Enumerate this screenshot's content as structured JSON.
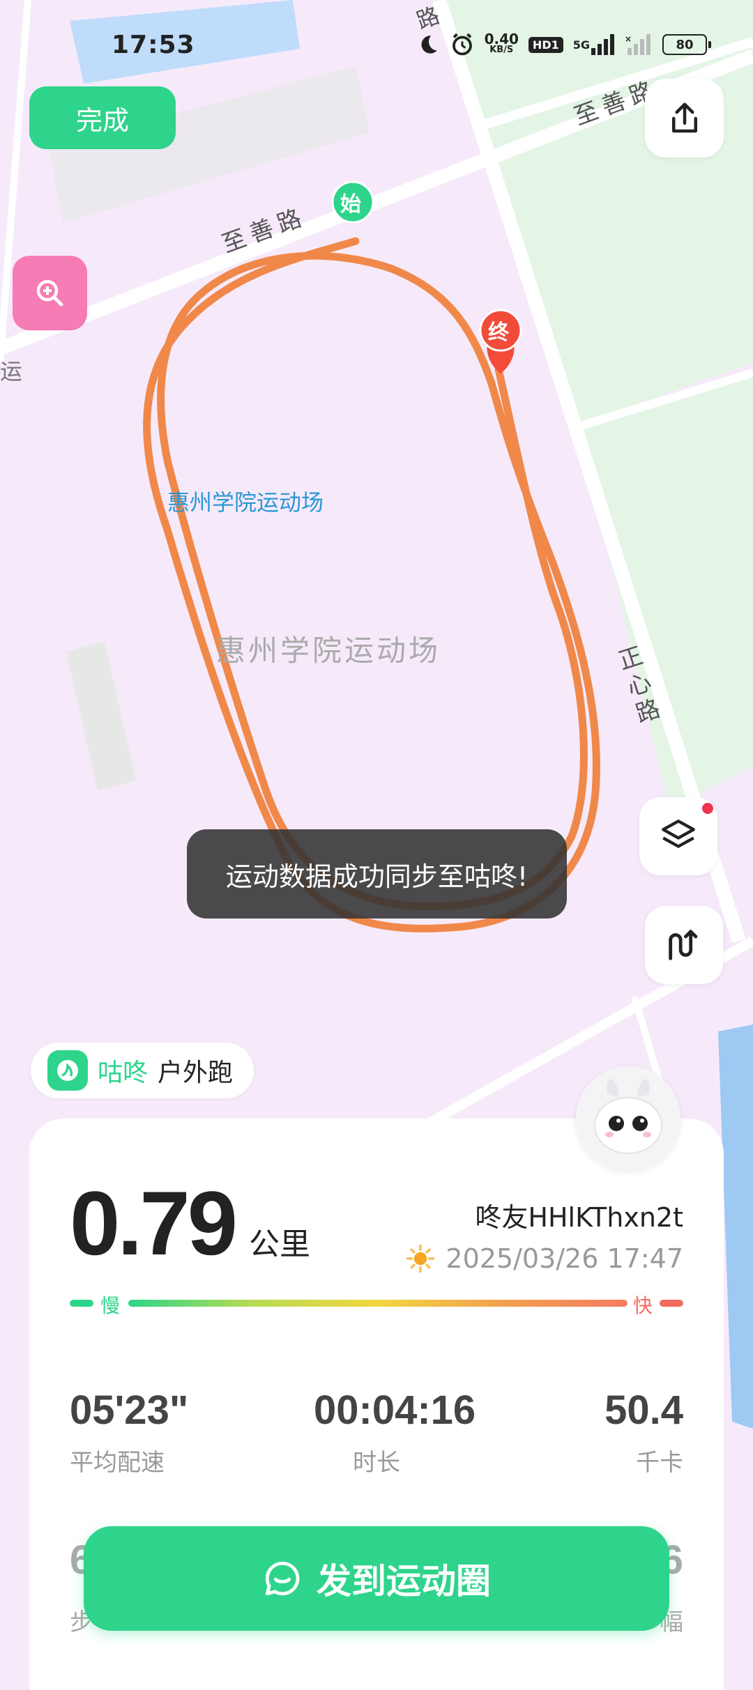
{
  "status_bar": {
    "time": "17:53",
    "net_speed": "0.40",
    "net_unit": "KB/S",
    "hd": "HD1",
    "signal": "5G",
    "battery": "80"
  },
  "map": {
    "road_north_top": "路",
    "road_north_right": "至善路",
    "road_north_left": "至善路",
    "road_east": "正心路",
    "edge_label": "运",
    "poi_label": "惠州学院运动场",
    "poi_label_big": "惠州学院运动场",
    "start_marker": "始",
    "end_marker": "终"
  },
  "buttons": {
    "done": "完成"
  },
  "toast": "运动数据成功同步至咕咚!",
  "brand": {
    "name": "咕咚",
    "type": "户外跑"
  },
  "summary": {
    "distance": "0.79",
    "distance_unit": "公里",
    "username": "咚友HHlKThxn2t",
    "datetime": "2025/03/26 17:47",
    "slow_label": "慢",
    "fast_label": "快"
  },
  "stats": [
    {
      "value": "05'23\"",
      "label": "平均配速"
    },
    {
      "value": "00:04:16",
      "label": "时长"
    },
    {
      "value": "50.4",
      "label": "千卡"
    }
  ],
  "stats_row2": {
    "left_value": "6",
    "left_label": "步",
    "right_value": "6",
    "right_label": "幅"
  },
  "post_button": "发到运动圈",
  "colors": {
    "accent": "#2ed48b",
    "route": "#f0884a",
    "map_bg": "#f6eafa",
    "park": "#e3f4e7"
  }
}
